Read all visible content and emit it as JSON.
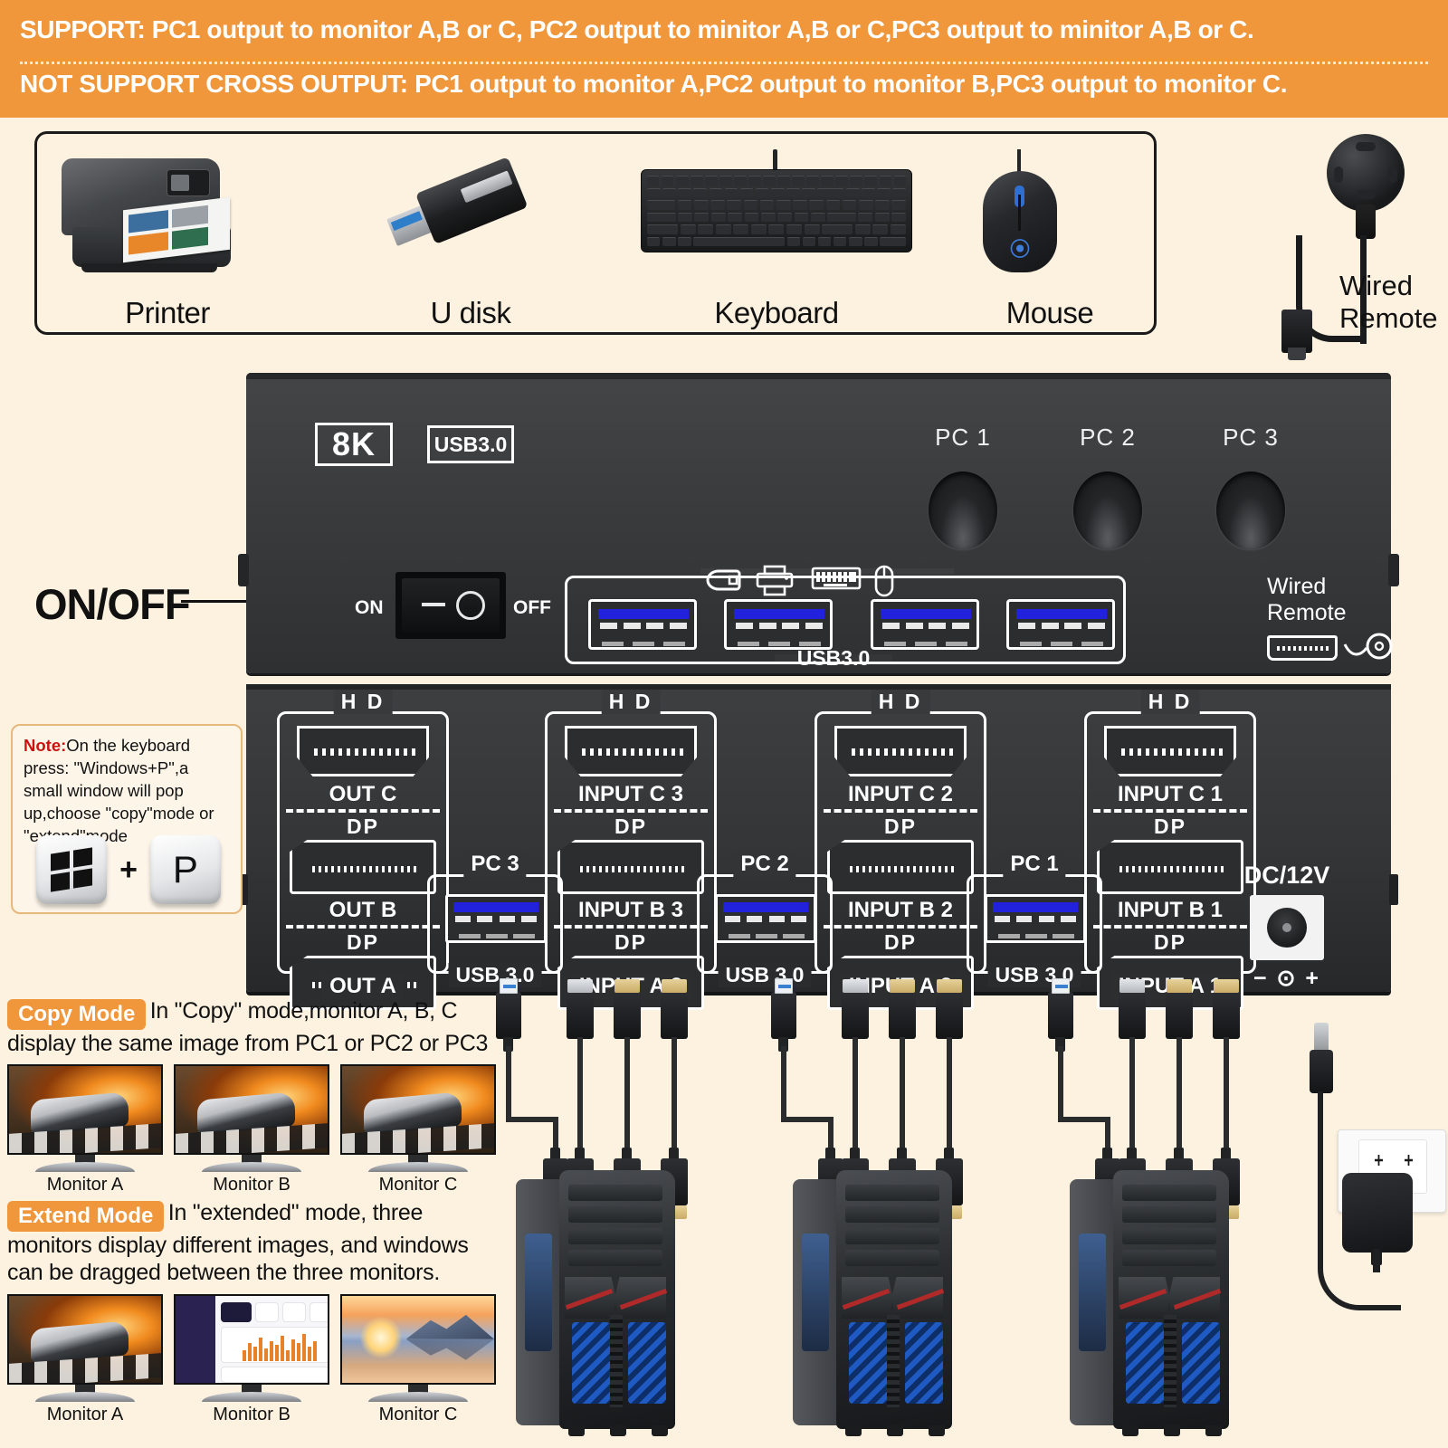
{
  "banner": {
    "line1": "SUPPORT: PC1 output to monitor A,B or C, PC2 output to minitor A,B or C,PC3 output to minitor A,B or C.",
    "line2": "NOT SUPPORT CROSS OUTPUT: PC1 output to monitor A,PC2 output to monitor B,PC3 output to monitor C.",
    "bg_color": "#f0963b"
  },
  "peripherals": [
    {
      "label": "Printer",
      "icon": "printer-icon"
    },
    {
      "label": "U disk",
      "icon": "usb-flash-drive-icon"
    },
    {
      "label": "Keyboard",
      "icon": "keyboard-icon"
    },
    {
      "label": "Mouse",
      "icon": "mouse-icon"
    }
  ],
  "wired_remote": {
    "label_line1": "Wired",
    "label_line2": "Remote"
  },
  "front_panel": {
    "badge_8k": "8K",
    "badge_usb3": "USB3.0",
    "pc_buttons": [
      "PC 1",
      "PC 2",
      "PC 3"
    ],
    "power_switch": {
      "callout": "ON/OFF",
      "on": "ON",
      "off": "OFF"
    },
    "usb_group_caption": "USB3.0",
    "usb_icons": [
      "usb-flash-drive-icon",
      "printer-icon",
      "keyboard-icon",
      "mouse-icon"
    ],
    "wired_remote_port": {
      "line1": "Wired",
      "line2": "Remote"
    }
  },
  "rear_panel": {
    "blocks": [
      {
        "title": "H D",
        "hdmi_label": "OUT C",
        "dp1_title": "DP",
        "dp1_label": "OUT B",
        "dp2_title": "DP",
        "dp2_label": "OUT A"
      },
      {
        "title": "H D",
        "hdmi_label": "INPUT C 3",
        "dp1_title": "DP",
        "dp1_label": "INPUT B 3",
        "dp2_title": "DP",
        "dp2_label": "INPUT A 3"
      },
      {
        "title": "H D",
        "hdmi_label": "INPUT C 2",
        "dp1_title": "DP",
        "dp1_label": "INPUT B 2",
        "dp2_title": "DP",
        "dp2_label": "INPUT A 2"
      },
      {
        "title": "H D",
        "hdmi_label": "INPUT C 1",
        "dp1_title": "DP",
        "dp1_label": "INPUT B 1",
        "dp2_title": "DP",
        "dp2_label": "INPUT A 1"
      }
    ],
    "usb_blocks": [
      {
        "title": "PC 3",
        "foot": "USB 3.0"
      },
      {
        "title": "PC 2",
        "foot": "USB 3.0"
      },
      {
        "title": "PC 1",
        "foot": "USB 3.0"
      }
    ],
    "dc": {
      "label": "DC/12V",
      "polarity": "-  +"
    }
  },
  "note": {
    "prefix": "Note:",
    "body": "On the keyboard press: \"Windows+P\",a small window will pop up,choose \"copy\"mode or \"extend\"mode",
    "key_win": "windows-key",
    "plus": "+",
    "key_p": "P"
  },
  "modes": [
    {
      "tag": "Copy Mode",
      "desc": "In \"Copy\" mode,monitor A, B, C display the same image from PC1 or PC2 or PC3",
      "monitors": [
        {
          "label": "Monitor A",
          "content": "racing-car"
        },
        {
          "label": "Monitor B",
          "content": "racing-car"
        },
        {
          "label": "Monitor C",
          "content": "racing-car"
        }
      ]
    },
    {
      "tag": "Extend Mode",
      "desc": "In \"extended\" mode, three monitors display different images, and windows can be dragged between the three monitors.",
      "monitors": [
        {
          "label": "Monitor A",
          "content": "racing-car"
        },
        {
          "label": "Monitor B",
          "content": "dashboard"
        },
        {
          "label": "Monitor C",
          "content": "lake-sunset"
        }
      ]
    }
  ],
  "colors": {
    "accent_orange": "#f0963b",
    "page_bg": "#fdf2e0",
    "device_black": "#333537",
    "usb3_blue": "#2222dd",
    "note_red": "#cc1111"
  }
}
